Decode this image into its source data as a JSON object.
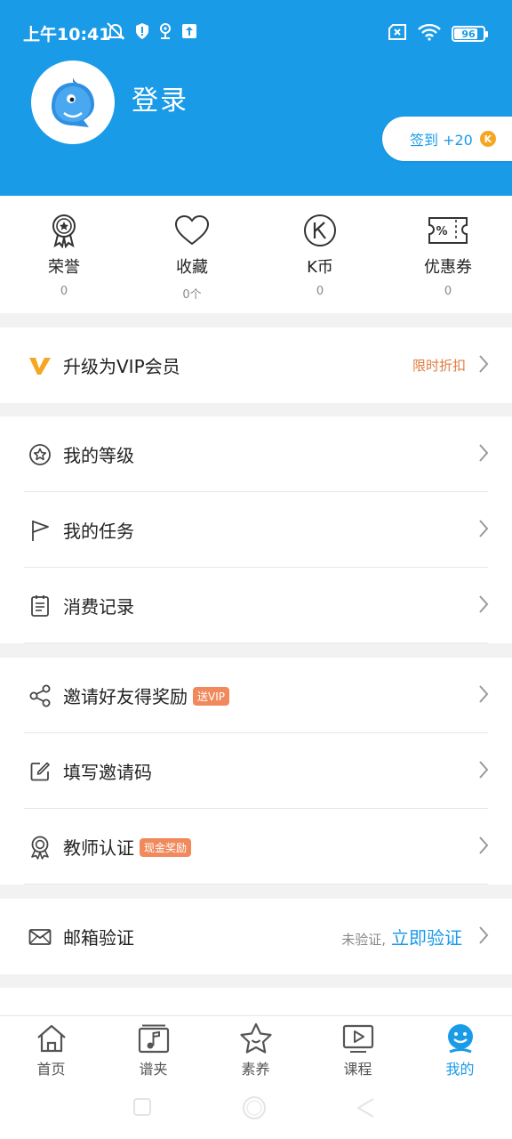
{
  "status_bar": {
    "time": "上午10:41",
    "battery": "96"
  },
  "header": {
    "login_text": "登录",
    "signin_label": "签到 +20",
    "coin_glyph": "K"
  },
  "stats": [
    {
      "label": "荣誉",
      "value": "0",
      "icon": "medal-icon"
    },
    {
      "label": "收藏",
      "value": "0个",
      "icon": "heart-icon"
    },
    {
      "label": "K币",
      "value": "0",
      "icon": "k-coin-icon"
    },
    {
      "label": "优惠券",
      "value": "0",
      "icon": "coupon-icon"
    }
  ],
  "vip": {
    "label": "升级为VIP会员",
    "right_text": "限时折扣",
    "icon": "vip-icon"
  },
  "group1": [
    {
      "label": "我的等级",
      "icon": "star-circle-icon"
    },
    {
      "label": "我的任务",
      "icon": "flag-icon"
    },
    {
      "label": "消费记录",
      "icon": "receipt-icon"
    }
  ],
  "group2": [
    {
      "label": "邀请好友得奖励",
      "badge": "送VIP",
      "icon": "share-icon"
    },
    {
      "label": "填写邀请码",
      "badge": "",
      "icon": "edit-icon"
    },
    {
      "label": "教师认证",
      "badge": "现金奖励",
      "icon": "certificate-icon"
    }
  ],
  "mail": {
    "label": "邮箱验证",
    "status": "未验证,",
    "action": "立即验证",
    "icon": "mail-icon"
  },
  "tabbar": [
    {
      "label": "首页",
      "icon": "home-icon",
      "active": false
    },
    {
      "label": "谱夹",
      "icon": "music-folder-icon",
      "active": false
    },
    {
      "label": "素养",
      "icon": "star-face-icon",
      "active": false
    },
    {
      "label": "课程",
      "icon": "play-icon",
      "active": false
    },
    {
      "label": "我的",
      "icon": "profile-icon",
      "active": true
    }
  ],
  "colors": {
    "primary": "#1a9be8",
    "accent": "#e07b3f",
    "vip_gold": "#f5a623"
  }
}
